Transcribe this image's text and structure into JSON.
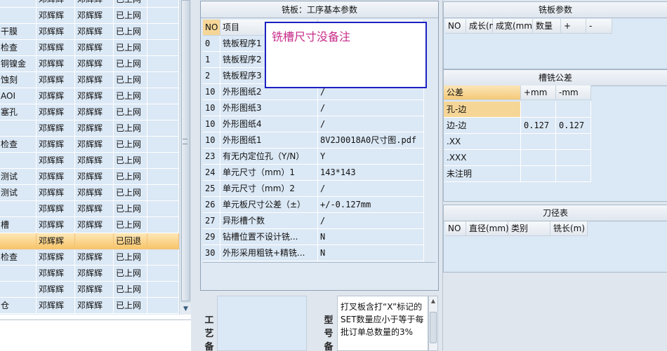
{
  "left_grid": {
    "rows": [
      {
        "c0": "",
        "c1": "邓辉辉",
        "c2": "邓辉辉",
        "c3": "已上网",
        "selected": false
      },
      {
        "c0": "",
        "c1": "邓辉辉",
        "c2": "邓辉辉",
        "c3": "已上网",
        "selected": false
      },
      {
        "c0": "干膜",
        "c1": "邓辉辉",
        "c2": "邓辉辉",
        "c3": "已上网",
        "selected": false
      },
      {
        "c0": "检查",
        "c1": "邓辉辉",
        "c2": "邓辉辉",
        "c3": "已上网",
        "selected": false
      },
      {
        "c0": "铜镍金",
        "c1": "邓辉辉",
        "c2": "邓辉辉",
        "c3": "已上网",
        "selected": false
      },
      {
        "c0": "蚀刻",
        "c1": "邓辉辉",
        "c2": "邓辉辉",
        "c3": "已上网",
        "selected": false
      },
      {
        "c0": "AOI",
        "c1": "邓辉辉",
        "c2": "邓辉辉",
        "c3": "已上网",
        "selected": false
      },
      {
        "c0": "塞孔",
        "c1": "邓辉辉",
        "c2": "邓辉辉",
        "c3": "已上网",
        "selected": false
      },
      {
        "c0": "",
        "c1": "邓辉辉",
        "c2": "邓辉辉",
        "c3": "已上网",
        "selected": false
      },
      {
        "c0": "检查",
        "c1": "邓辉辉",
        "c2": "邓辉辉",
        "c3": "已上网",
        "selected": false
      },
      {
        "c0": "",
        "c1": "邓辉辉",
        "c2": "邓辉辉",
        "c3": "已上网",
        "selected": false
      },
      {
        "c0": "测试",
        "c1": "邓辉辉",
        "c2": "邓辉辉",
        "c3": "已上网",
        "selected": false
      },
      {
        "c0": "测试",
        "c1": "邓辉辉",
        "c2": "邓辉辉",
        "c3": "已上网",
        "selected": false
      },
      {
        "c0": "",
        "c1": "邓辉辉",
        "c2": "邓辉辉",
        "c3": "已上网",
        "selected": false
      },
      {
        "c0": "槽",
        "c1": "邓辉辉",
        "c2": "邓辉辉",
        "c3": "已上网",
        "selected": false
      },
      {
        "c0": "",
        "c1": "邓辉辉",
        "c2": "",
        "c3": "已回退",
        "selected": true
      },
      {
        "c0": "检查",
        "c1": "邓辉辉",
        "c2": "邓辉辉",
        "c3": "已上网",
        "selected": false
      },
      {
        "c0": "",
        "c1": "邓辉辉",
        "c2": "邓辉辉",
        "c3": "已上网",
        "selected": false
      },
      {
        "c0": "",
        "c1": "邓辉辉",
        "c2": "邓辉辉",
        "c3": "已上网",
        "selected": false
      },
      {
        "c0": "仓",
        "c1": "邓辉辉",
        "c2": "邓辉辉",
        "c3": "已上网",
        "selected": false
      }
    ]
  },
  "mid": {
    "title": "铣板：工序基本参数",
    "headers": {
      "no": "NO",
      "item": "项目",
      "value": ""
    },
    "rows": [
      {
        "no": "0",
        "item": "铣板程序1",
        "value": ""
      },
      {
        "no": "1",
        "item": "铣板程序2",
        "value": ""
      },
      {
        "no": "2",
        "item": "铣板程序3",
        "value": ""
      },
      {
        "no": "10",
        "item": "外形图纸2",
        "value": "/"
      },
      {
        "no": "10",
        "item": "外形图纸3",
        "value": "/"
      },
      {
        "no": "10",
        "item": "外形图纸4",
        "value": "/"
      },
      {
        "no": "10",
        "item": "外形图纸1",
        "value": "8V2J0018A0尺寸图.pdf"
      },
      {
        "no": "23",
        "item": "有无内定位孔（Y/N）",
        "value": "Y"
      },
      {
        "no": "24",
        "item": "单元尺寸（mm）1",
        "value": "143*143"
      },
      {
        "no": "25",
        "item": "单元尺寸（mm）2",
        "value": "/"
      },
      {
        "no": "26",
        "item": "单元板尺寸公差（±）",
        "value": "+/-0.127mm"
      },
      {
        "no": "27",
        "item": "异形槽个数",
        "value": "/"
      },
      {
        "no": "29",
        "item": "钻槽位置不设计铣...",
        "value": "N"
      },
      {
        "no": "30",
        "item": "外形采用粗铣+精铣...",
        "value": "N"
      }
    ],
    "note": "铣槽尺寸没备注"
  },
  "mid_bottom": {
    "craft_label": "工艺备",
    "model_label": "型号备",
    "model_text": "打叉板含打“X”标记的SET数量应小于等于每批订单总数量的3%"
  },
  "right": {
    "board_params": {
      "title": "铣板参数",
      "headers": [
        "NO",
        "成长(mm)",
        "成宽(mm)",
        "数量",
        "+",
        "-"
      ]
    },
    "tolerance": {
      "title": "槽铣公差",
      "headers": [
        "公差",
        "+mm",
        "-mm"
      ],
      "rows": [
        {
          "name": "孔-边",
          "plus": "",
          "minus": ""
        },
        {
          "name": "边-边",
          "plus": "0.127",
          "minus": "0.127"
        },
        {
          "name": ".XX",
          "plus": "",
          "minus": ""
        },
        {
          "name": ".XXX",
          "plus": "",
          "minus": ""
        },
        {
          "name": "未注明",
          "plus": "",
          "minus": ""
        }
      ]
    },
    "tools": {
      "title": "刀径表",
      "headers": [
        "NO",
        "直径(mm)",
        "类别",
        "铣长(m)"
      ]
    }
  }
}
